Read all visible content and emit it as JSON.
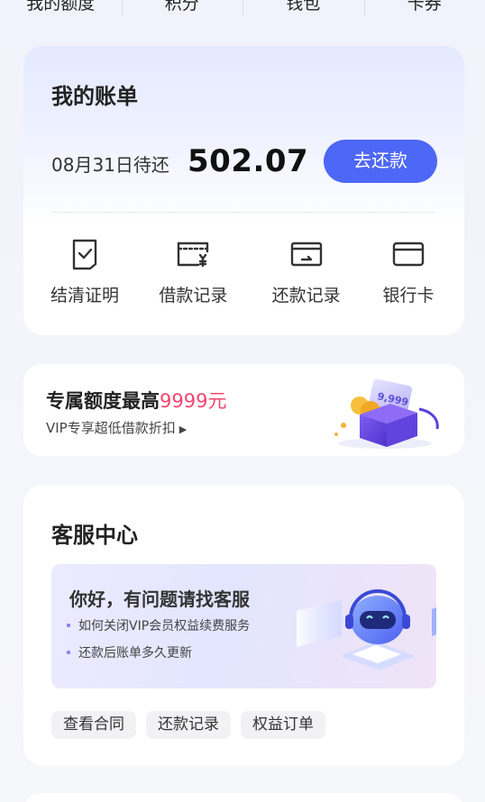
{
  "top_tabs": [
    "我的额度",
    "积分",
    "钱包",
    "卡券"
  ],
  "bill": {
    "title": "我的账单",
    "due_date": "08月31日待还",
    "amount": "502.07",
    "repay_button": "去还款",
    "actions": [
      {
        "label": "结清证明",
        "icon": "check-document-icon"
      },
      {
        "label": "借款记录",
        "icon": "wallet-yen-icon"
      },
      {
        "label": "还款记录",
        "icon": "wallet-return-icon"
      },
      {
        "label": "银行卡",
        "icon": "bank-card-icon"
      }
    ]
  },
  "credit": {
    "title_prefix": "专属额度最高",
    "title_highlight": "9999元",
    "subtitle": "VIP专享超低借款折扣",
    "gift_text": "9,999",
    "colors": {
      "highlight": "#f0466e"
    }
  },
  "service": {
    "title": "客服中心",
    "greeting": "你好，有问题请找客服",
    "faqs": [
      "如何关闭VIP会员权益续费服务",
      "还款后账单多久更新"
    ],
    "chips": [
      "查看合同",
      "还款记录",
      "权益订单"
    ]
  },
  "colors": {
    "accent": "#4d67f6"
  }
}
